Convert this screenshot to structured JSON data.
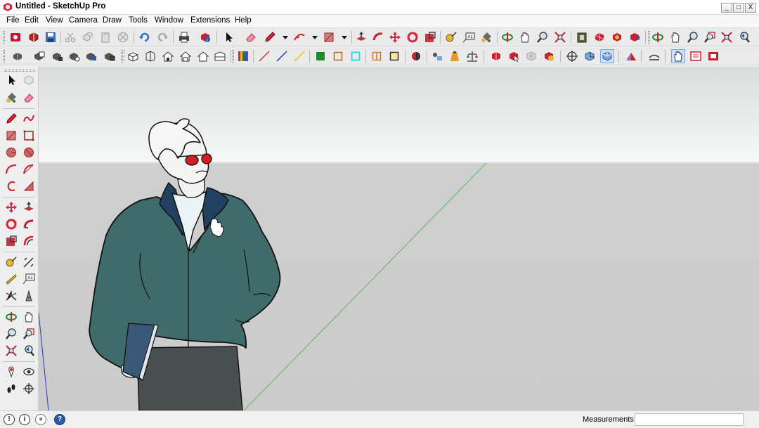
{
  "window": {
    "title": "Untitled - SketchUp Pro",
    "controls": {
      "minimize": "_",
      "maximize": "□",
      "close": "X"
    }
  },
  "menu": [
    "File",
    "Edit",
    "View",
    "Camera",
    "Draw",
    "Tools",
    "Window",
    "Extensions",
    "Help"
  ],
  "toolbar_row_1": [
    "getting-started-icon",
    "cut-icon",
    "copy-icon",
    "paste-icon",
    "erase-selection-icon",
    "undo-icon",
    "redo-icon",
    "print-icon",
    "model-info-icon",
    "select-icon",
    "eraser-icon",
    "pencil-icon",
    "arc-icon",
    "rectangle-icon",
    "push-pull-icon",
    "follow-me-icon",
    "move-icon",
    "rotate-icon",
    "scale-icon",
    "tape-measure-icon",
    "text-icon",
    "paint-bucket-icon",
    "orbit-icon",
    "pan-icon",
    "zoom-icon",
    "zoom-extents-icon",
    "warehouse-icon",
    "share-model-icon",
    "components-icon",
    "extension-warehouse-icon",
    "add-location-icon",
    "walk-icon",
    "look-around-icon",
    "zoom-window-icon",
    "zoom-extents-2-icon",
    "previous-view-icon"
  ],
  "toolbar_row_2": [
    "styles-icon",
    "section-plane-icon",
    "views-iso-icon",
    "views-top-icon",
    "views-front-icon",
    "views-right-icon",
    "views-back-icon",
    "views-left-icon",
    "xray-icon",
    "back-edges-icon",
    "wireframe-icon",
    "hidden-line-icon",
    "shaded-icon",
    "shaded-textures-icon",
    "monochrome-icon",
    "section-display-icon",
    "section-fill-icon",
    "shadows-icon",
    "sandbox-icon",
    "solid-union-icon",
    "solid-intersect-icon",
    "dynamic-components-icon",
    "interact-icon",
    "options-icon",
    "attributes-icon",
    "position-camera-icon",
    "perspective-icon",
    "standard-views-icon",
    "warehouse-upload-icon",
    "smoove-icon",
    "hand-icon",
    "layout-icon",
    "extension-manager-icon"
  ],
  "status": {
    "measurements_label": "Measurements",
    "measurements_value": ""
  },
  "colors": {
    "jacket": "#3f6b6a",
    "pants": "#4a4f4f",
    "lens": "#d21f26",
    "green_axis": "#6fb96f",
    "blue_axis": "#2d37c4",
    "accent": "#c8102e"
  }
}
